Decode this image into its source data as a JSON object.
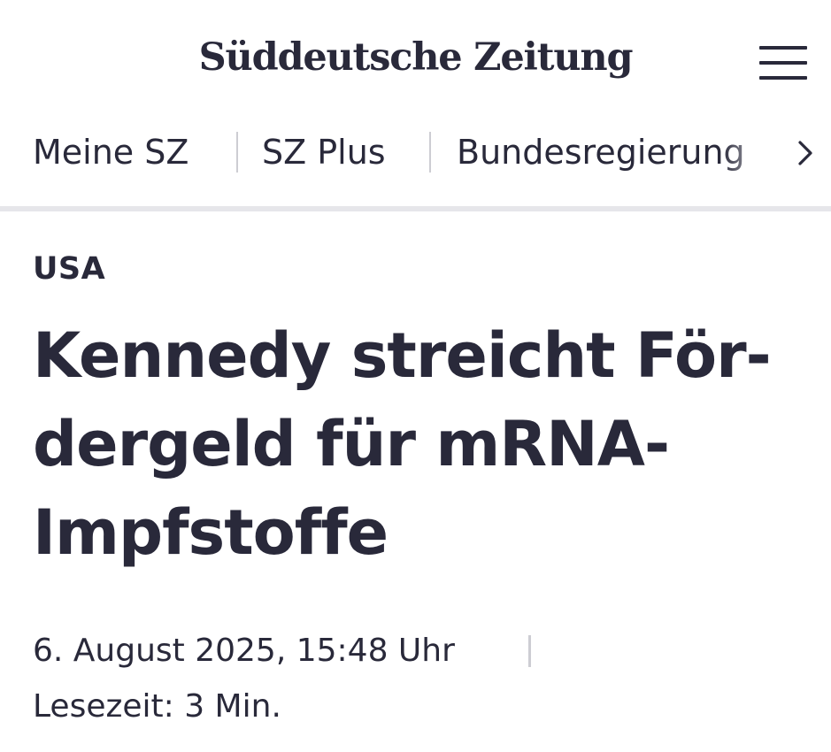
{
  "header": {
    "logo_text": "Süddeutsche Zeitung",
    "menu_icon": "hamburger-menu-icon"
  },
  "nav": {
    "items": [
      {
        "label": "Meine SZ"
      },
      {
        "label": "SZ Plus"
      },
      {
        "label": "Bundesregierung"
      }
    ],
    "more_icon": "chevron-right-icon"
  },
  "article": {
    "kicker": "USA",
    "headline_lines": [
      "Kennedy streicht För-",
      "dergeld für mRNA-",
      "Impfstoffe"
    ],
    "date": "6. August 2025, 15:48 Uhr",
    "reading_time": "Lesezeit: 3 Min."
  },
  "colors": {
    "text": "#29293a",
    "separator": "#cdcdd3",
    "divider": "#e6e6ea",
    "background": "#ffffff"
  }
}
